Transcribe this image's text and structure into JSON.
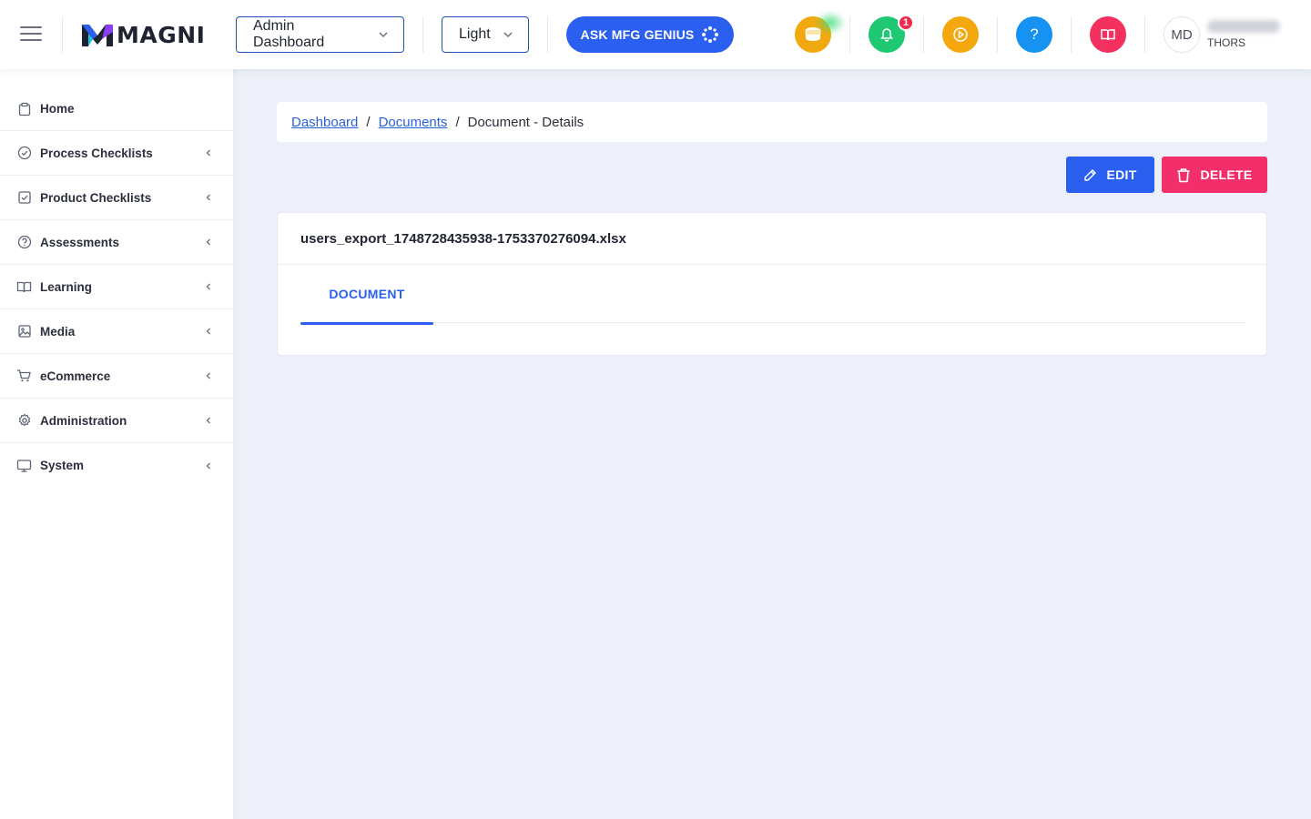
{
  "header": {
    "logo_text": "MAGNI",
    "dashboard_select": {
      "value": "Admin Dashboard"
    },
    "theme_select": {
      "value": "Light"
    },
    "ask_button": "ASK MFG GENIUS",
    "notification_count": "1",
    "help_label": "?",
    "user": {
      "initials": "MD",
      "org": "THORS"
    },
    "colors": {
      "coins": "#f2a90f",
      "bell": "#1fc872",
      "play": "#f4a80d",
      "help": "#1592f2",
      "book": "#f4305f"
    }
  },
  "sidebar": {
    "items": [
      {
        "label": "Home",
        "icon": "clipboard-icon",
        "has_arrow": false
      },
      {
        "label": "Process Checklists",
        "icon": "check-circle-icon",
        "has_arrow": true
      },
      {
        "label": "Product Checklists",
        "icon": "check-square-icon",
        "has_arrow": true
      },
      {
        "label": "Assessments",
        "icon": "question-circle-icon",
        "has_arrow": true
      },
      {
        "label": "Learning",
        "icon": "book-open-icon",
        "has_arrow": true
      },
      {
        "label": "Media",
        "icon": "image-icon",
        "has_arrow": true
      },
      {
        "label": "eCommerce",
        "icon": "cart-icon",
        "has_arrow": true
      },
      {
        "label": "Administration",
        "icon": "gear-icon",
        "has_arrow": true
      },
      {
        "label": "System",
        "icon": "monitor-icon",
        "has_arrow": true
      }
    ]
  },
  "breadcrumb": {
    "items": [
      "Dashboard",
      "Documents"
    ],
    "separator": "/",
    "current": "Document - Details"
  },
  "actions": {
    "edit_label": "EDIT",
    "delete_label": "DELETE"
  },
  "document": {
    "filename": "users_export_1748728435938-1753370276094.xlsx",
    "tabs": [
      {
        "label": "DOCUMENT",
        "active": true
      }
    ]
  }
}
